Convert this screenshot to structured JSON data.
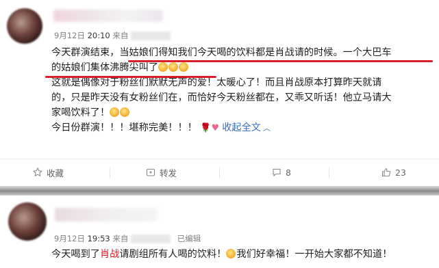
{
  "post1": {
    "date": "9月12日",
    "time": "20:10",
    "source_prefix": "来自",
    "lines": [
      {
        "a": "今天群演结束，",
        "b": "当姑娘们得知我们今天喝的饮料都是肖战请的时候。一个大巴车"
      },
      {
        "a": "的姑娘们集体沸腾尖叫了"
      },
      {
        "a": "这就是偶像对于粉丝们默默无声的爱！太暖心了！而且肖战原本打算昨天就请"
      },
      {
        "a": "的，只是昨天没有女粉丝们在，而恰好今天粉丝都在，又乖又听话！他立马请大"
      },
      {
        "a": "家喝饮料了！"
      },
      {
        "a": "今日份群演！！！堪称完美！！！"
      }
    ],
    "expand_label": "收起全文",
    "actions": {
      "favorite": "收藏",
      "repost": "转发",
      "comment_count": "8",
      "like_count": "23"
    }
  },
  "post2": {
    "date": "9月12日",
    "time": "19:53",
    "source_prefix": "来自",
    "edited_label": "已编辑",
    "line1_a": "今天喝到了",
    "line1_highlight": "肖战",
    "line1_b": "请剧组所有人喝的饮料！",
    "line1_c": "我们好幸福！一开始大家都不知道！"
  },
  "colors": {
    "highlight_text": "#e0161d",
    "underline": "#d81e2a",
    "link": "#3b6fb6",
    "muted": "#808080"
  },
  "icons": [
    "favorite-icon",
    "repost-icon",
    "comment-icon",
    "like-icon",
    "emoji-icon",
    "rose-icon",
    "heart-icon",
    "chevron-up-icon"
  ]
}
